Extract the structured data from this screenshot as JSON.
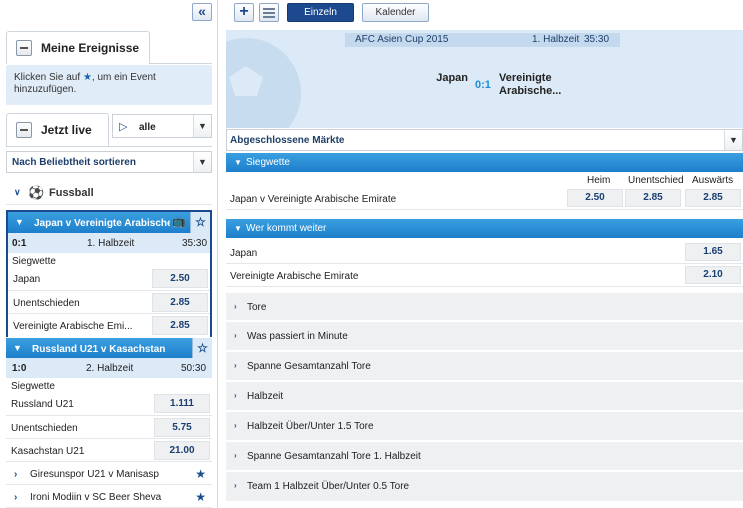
{
  "left": {
    "my_events": {
      "title": "Meine Ereignisse",
      "info_before": "Klicken Sie auf",
      "info_after": ", um ein Event hinzuzufügen."
    },
    "live": {
      "title": "Jetzt live",
      "filter_value": "alle",
      "sort_value": "Nach Beliebtheit sortieren"
    },
    "sport_label": "Fussball",
    "events": [
      {
        "name": "Japan v Vereinigte Arabische Emirate",
        "score": "0:1",
        "period": "1. Halbzeit",
        "time": "35:30",
        "market": "Siegwette",
        "odds": [
          {
            "label": "Japan",
            "value": "2.50"
          },
          {
            "label": "Unentschieden",
            "value": "2.85"
          },
          {
            "label": "Vereinigte Arabische Emi...",
            "value": "2.85"
          }
        ]
      },
      {
        "name": "Russland U21 v Kasachstan",
        "score": "1:0",
        "period": "2. Halbzeit",
        "time": "50:30",
        "market": "Siegwette",
        "odds": [
          {
            "label": "Russland U21",
            "value": "1.111"
          },
          {
            "label": "Unentschieden",
            "value": "5.75"
          },
          {
            "label": "Kasachstan U21",
            "value": "21.00"
          }
        ]
      }
    ],
    "more_events": [
      "Giresunspor U21 v Manisasp",
      "Ironi Modiin v SC Beer Sheva"
    ]
  },
  "toolbar": {
    "single_label": "Einzeln",
    "calendar_label": "Kalender"
  },
  "match": {
    "competition": "AFC Asien Cup 2015",
    "period": "1. Halbzeit",
    "time": "35:30",
    "home": "Japan",
    "score": "0:1",
    "away_line1": "Vereinigte",
    "away_line2": "Arabische..."
  },
  "markets": {
    "dropdown_value": "Abgeschlossene Märkte",
    "siegwette": {
      "title": "Siegwette",
      "col_home": "Heim",
      "col_draw": "Unentschied",
      "col_away": "Auswärts",
      "row_label": "Japan v Vereinigte Arabische Emirate",
      "home": "2.50",
      "draw": "2.85",
      "away": "2.85"
    },
    "next_round": {
      "title": "Wer kommt weiter",
      "rows": [
        {
          "label": "Japan",
          "value": "1.65"
        },
        {
          "label": "Vereinigte Arabische Emirate",
          "value": "2.10"
        }
      ]
    },
    "collapsed": [
      "Tore",
      "Was passiert in Minute",
      "Spanne Gesamtanzahl Tore",
      "Halbzeit",
      "Halbzeit Über/Unter 1.5 Tore",
      "Spanne Gesamtanzahl Tore 1. Halbzeit",
      "Team 1 Halbzeit Über/Unter 0.5 Tore"
    ]
  }
}
